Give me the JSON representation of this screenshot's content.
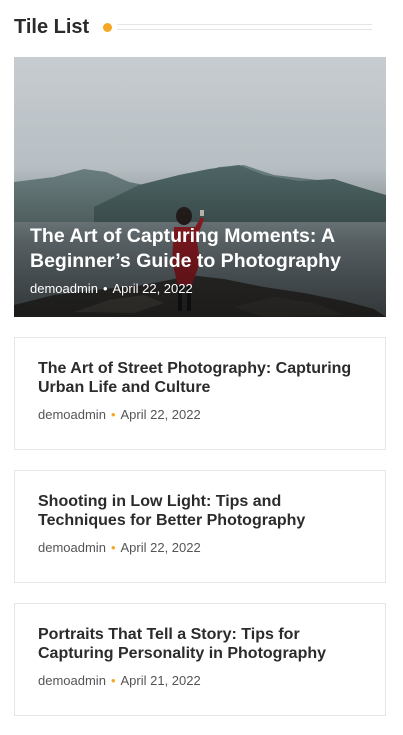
{
  "widget": {
    "title": "Tile List",
    "accent_color": "#f5a623"
  },
  "featured": {
    "title": "The Art of Capturing Moments: A Beginner’s Guide to Photography",
    "author": "demoadmin",
    "separator": "•",
    "date": "April 22, 2022",
    "image": "woman-in-red-coat-photographing-misty-mountains"
  },
  "posts": [
    {
      "title": "The Art of Street Photography: Capturing Urban Life and Culture",
      "author": "demoadmin",
      "separator": "•",
      "date": "April 22, 2022"
    },
    {
      "title": "Shooting in Low Light: Tips and Techniques for Better Photography",
      "author": "demoadmin",
      "separator": "•",
      "date": "April 22, 2022"
    },
    {
      "title": "Portraits That Tell a Story: Tips for Capturing Personality in Photography",
      "author": "demoadmin",
      "separator": "•",
      "date": "April 21, 2022"
    }
  ]
}
